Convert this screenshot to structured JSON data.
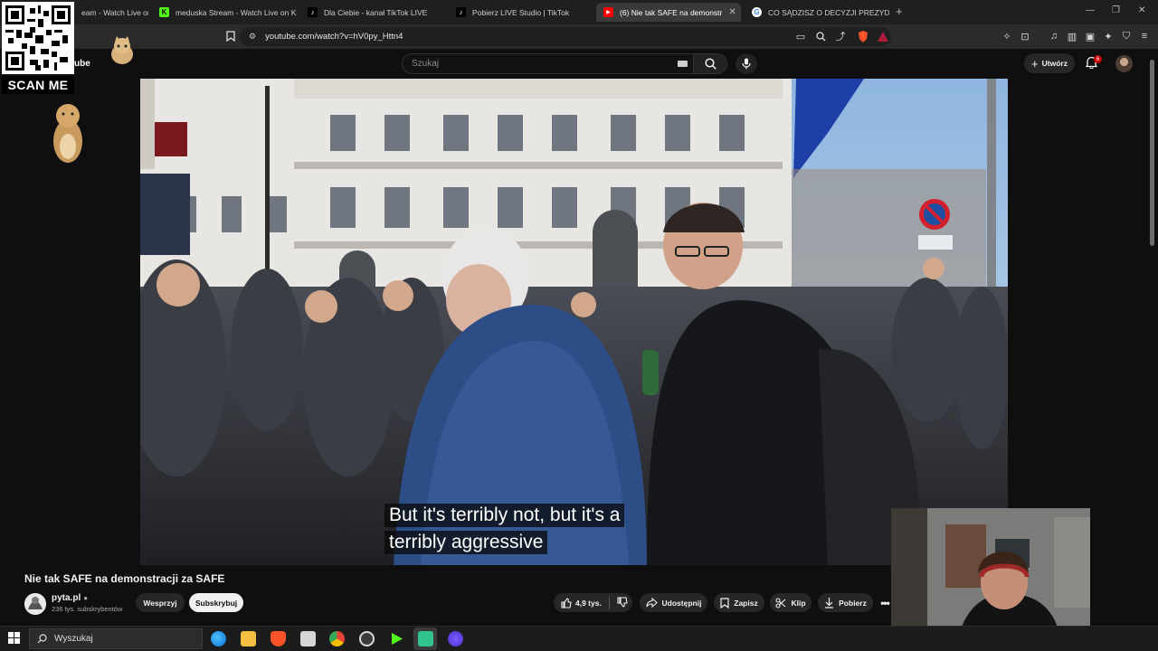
{
  "browser": {
    "tabs": [
      {
        "label": "eam - Watch Live on",
        "favicon": "kick-icon",
        "active": false
      },
      {
        "label": "meduska Stream - Watch Live on Kic",
        "favicon": "kick-icon",
        "active": false
      },
      {
        "label": "Dla Ciebie - kanał TikTok LIVE",
        "favicon": "tiktok-icon",
        "active": false
      },
      {
        "label": "Pobierz LIVE Studio | TikTok",
        "favicon": "tiktok-icon",
        "active": false
      },
      {
        "label": "(6) Nie tak SAFE na demonstr",
        "favicon": "youtube-icon",
        "active": true
      },
      {
        "label": "CO SĄDZISZ O DECYZJI PREZYDENTA",
        "favicon": "google-icon",
        "active": false
      }
    ],
    "url": "youtube.com/watch?v=hV0py_Httn4"
  },
  "youtube": {
    "search_placeholder": "Szukaj",
    "create_label": "Utwórz",
    "notifications_count": "6",
    "logo_fragment": "ube"
  },
  "overlay": {
    "scan_me": "SCAN ME"
  },
  "video": {
    "subtitle_line1": "But it's terribly not, but it's a",
    "subtitle_line2": "terribly aggressive"
  },
  "below_video": {
    "title": "Nie tak SAFE na demonstracji za SAFE",
    "channel_name": "pyta.pl",
    "subscribers": "236 tys. subskrybentów",
    "join_label": "Wesprzyj",
    "subscribe_label": "Subskrybuj",
    "likes": "4,9 tys.",
    "share_label": "Udostępnij",
    "save_label": "Zapisz",
    "clip_label": "Klip",
    "download_label": "Pobierz"
  },
  "taskbar": {
    "search_placeholder": "Wyszukaj"
  },
  "colors": {
    "youtube_red": "#ff0000",
    "background": "#0f0f0f",
    "subtitle_bg": "#080808"
  }
}
